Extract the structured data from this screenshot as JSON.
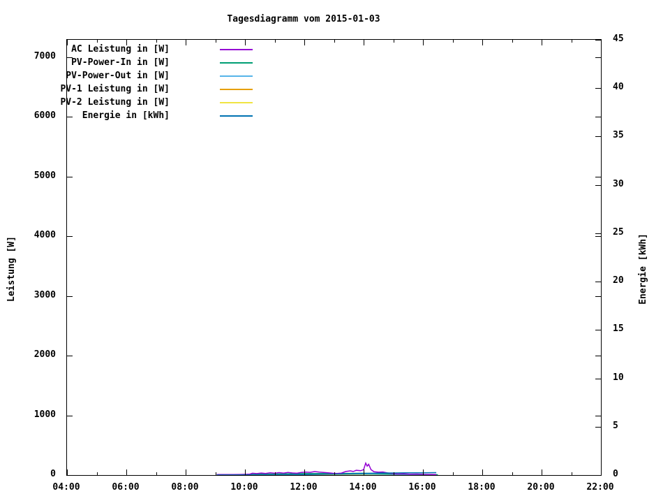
{
  "title": "Tagesdiagramm vom 2015-01-03",
  "chart_data": {
    "type": "line",
    "title": "Tagesdiagramm vom 2015-01-03",
    "grid": false,
    "legend_position": "top-left-inside",
    "x_axis": {
      "start_hour": 4,
      "end_hour": 22,
      "major_tick_every_hours": 2,
      "minor_tick_every_hours": 1,
      "tick_hours": [
        4,
        6,
        8,
        10,
        12,
        14,
        16,
        18,
        20,
        22
      ],
      "tick_labels": [
        "04:00",
        "06:00",
        "08:00",
        "10:00",
        "12:00",
        "14:00",
        "16:00",
        "18:00",
        "20:00",
        "22:00"
      ]
    },
    "y_left": {
      "label": "Leistung [W]",
      "ticks": [
        0,
        1000,
        2000,
        3000,
        4000,
        5000,
        6000,
        7000
      ],
      "min": 0,
      "axis_top": 7292
    },
    "y_right": {
      "label": "Energie [kWh]",
      "ticks": [
        0,
        5,
        10,
        15,
        20,
        25,
        30,
        35,
        40,
        45
      ],
      "min": 0,
      "max": 45
    },
    "series": [
      {
        "name": "AC Leistung in [W]",
        "color": "#9400d3",
        "axis": "left",
        "points": [
          [
            9.05,
            8
          ],
          [
            9.3,
            8
          ],
          [
            9.6,
            9
          ],
          [
            9.9,
            10
          ],
          [
            10.15,
            14
          ],
          [
            10.25,
            30
          ],
          [
            10.4,
            24
          ],
          [
            10.55,
            34
          ],
          [
            10.7,
            27
          ],
          [
            10.85,
            38
          ],
          [
            11.0,
            30
          ],
          [
            11.15,
            41
          ],
          [
            11.3,
            33
          ],
          [
            11.45,
            43
          ],
          [
            11.6,
            35
          ],
          [
            11.75,
            30
          ],
          [
            11.9,
            44
          ],
          [
            12.05,
            50
          ],
          [
            12.2,
            46
          ],
          [
            12.35,
            58
          ],
          [
            12.5,
            50
          ],
          [
            12.65,
            44
          ],
          [
            12.8,
            38
          ],
          [
            12.95,
            30
          ],
          [
            13.1,
            26
          ],
          [
            13.25,
            33
          ],
          [
            13.4,
            60
          ],
          [
            13.55,
            70
          ],
          [
            13.65,
            60
          ],
          [
            13.75,
            80
          ],
          [
            13.9,
            72
          ],
          [
            14.0,
            90
          ],
          [
            14.07,
            200
          ],
          [
            14.12,
            150
          ],
          [
            14.17,
            180
          ],
          [
            14.25,
            90
          ],
          [
            14.35,
            55
          ],
          [
            14.5,
            48
          ],
          [
            14.65,
            52
          ],
          [
            14.8,
            36
          ],
          [
            14.95,
            24
          ],
          [
            15.15,
            18
          ],
          [
            15.35,
            20
          ],
          [
            15.55,
            14
          ],
          [
            15.8,
            16
          ],
          [
            16.05,
            12
          ],
          [
            16.25,
            10
          ],
          [
            16.45,
            8
          ]
        ]
      },
      {
        "name": "PV-Power-In in [W]",
        "color": "#009e73",
        "axis": "left",
        "points": [
          [
            9.05,
            4
          ],
          [
            10,
            10
          ],
          [
            11,
            18
          ],
          [
            12,
            24
          ],
          [
            13,
            26
          ],
          [
            13.5,
            28
          ],
          [
            14,
            30
          ],
          [
            14.5,
            24
          ],
          [
            15,
            18
          ],
          [
            15.5,
            14
          ],
          [
            16,
            10
          ],
          [
            16.5,
            6
          ]
        ]
      },
      {
        "name": "PV-Power-Out in [W]",
        "color": "#56b4e9",
        "axis": "left",
        "points": [
          [
            9.05,
            2
          ],
          [
            10,
            5
          ],
          [
            11,
            9
          ],
          [
            12,
            13
          ],
          [
            13,
            15
          ],
          [
            14,
            16
          ],
          [
            14.5,
            13
          ],
          [
            15,
            10
          ],
          [
            16,
            6
          ],
          [
            16.5,
            3
          ]
        ]
      },
      {
        "name": "PV-1 Leistung in [W]",
        "color": "#e69f00",
        "axis": "left",
        "points": [
          [
            9.05,
            1
          ],
          [
            16.5,
            1
          ]
        ]
      },
      {
        "name": "PV-2 Leistung in [W]",
        "color": "#f0e442",
        "axis": "left",
        "points": [
          [
            9.05,
            1
          ],
          [
            16.5,
            1
          ]
        ]
      },
      {
        "name": "Energie in [kWh]",
        "color": "#0072b2",
        "axis": "right",
        "points": [
          [
            9.05,
            0
          ],
          [
            10,
            0.01
          ],
          [
            11,
            0.03
          ],
          [
            12,
            0.06
          ],
          [
            13,
            0.1
          ],
          [
            13.5,
            0.13
          ],
          [
            14,
            0.16
          ],
          [
            14.3,
            0.19
          ],
          [
            14.6,
            0.21
          ],
          [
            15,
            0.22
          ],
          [
            15.5,
            0.23
          ],
          [
            16,
            0.24
          ],
          [
            16.45,
            0.25
          ]
        ]
      }
    ]
  }
}
